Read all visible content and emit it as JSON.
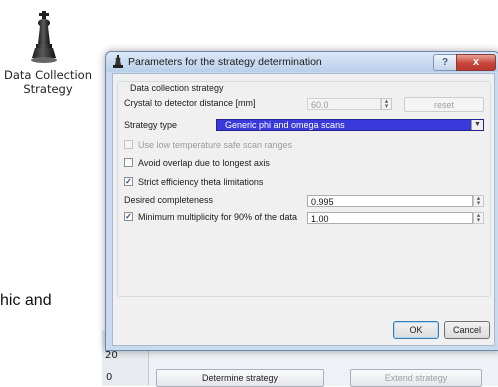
{
  "app": {
    "icon_name": "chess-pawn-icon",
    "label_line1": "Data Collection",
    "label_line2": "Strategy",
    "body_text_fragment": "hic and",
    "row_numbers": [
      "20",
      "0"
    ],
    "determine_button": "Determine strategy",
    "extend_button": "Extend strategy"
  },
  "dialog": {
    "title": "Parameters for the strategy determination",
    "icon_name": "chess-pawn-icon",
    "help_label": "?",
    "close_label": "x",
    "group_title": "Data collection strategy",
    "distance": {
      "label": "Crystal to detector distance [mm]",
      "value": "60.0",
      "enabled": false,
      "reset_label": "reset"
    },
    "strategy_type": {
      "label": "Strategy type",
      "selected": "Generic phi and omega scans"
    },
    "checkboxes": [
      {
        "label": "Use low temperature safe scan ranges",
        "checked": false,
        "enabled": false
      },
      {
        "label": "Avoid overlap due to longest axis",
        "checked": false,
        "enabled": true
      },
      {
        "label": "Strict efficiency theta limitations",
        "checked": true,
        "enabled": true
      }
    ],
    "completeness": {
      "label": "Desired completeness",
      "value": "0.995"
    },
    "multiplicity": {
      "label": "Minimum multiplicity for 90% of the data",
      "checked": true,
      "value": "1.00"
    },
    "ok_label": "OK",
    "cancel_label": "Cancel"
  }
}
